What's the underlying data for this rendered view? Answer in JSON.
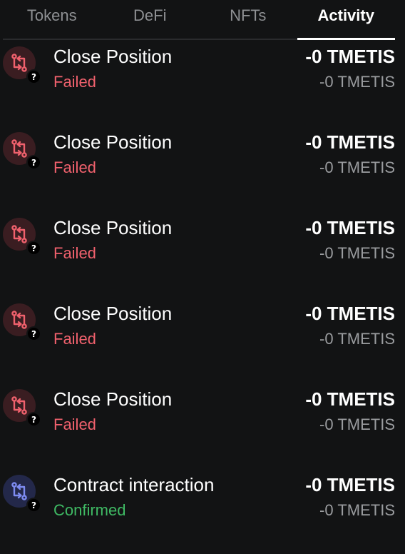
{
  "tabs": [
    {
      "label": "Tokens",
      "active": false
    },
    {
      "label": "DeFi",
      "active": false
    },
    {
      "label": "NFTs",
      "active": false
    },
    {
      "label": "Activity",
      "active": true
    }
  ],
  "activity": [
    {
      "title": "Close Position",
      "status": "Failed",
      "status_kind": "failed",
      "amount": "-0 TMETIS",
      "secondary_amount": "-0 TMETIS",
      "icon": "swap-arrows-icon",
      "badge": "?"
    },
    {
      "title": "Close Position",
      "status": "Failed",
      "status_kind": "failed",
      "amount": "-0 TMETIS",
      "secondary_amount": "-0 TMETIS",
      "icon": "swap-arrows-icon",
      "badge": "?"
    },
    {
      "title": "Close Position",
      "status": "Failed",
      "status_kind": "failed",
      "amount": "-0 TMETIS",
      "secondary_amount": "-0 TMETIS",
      "icon": "swap-arrows-icon",
      "badge": "?"
    },
    {
      "title": "Close Position",
      "status": "Failed",
      "status_kind": "failed",
      "amount": "-0 TMETIS",
      "secondary_amount": "-0 TMETIS",
      "icon": "swap-arrows-icon",
      "badge": "?"
    },
    {
      "title": "Close Position",
      "status": "Failed",
      "status_kind": "failed",
      "amount": "-0 TMETIS",
      "secondary_amount": "-0 TMETIS",
      "icon": "swap-arrows-icon",
      "badge": "?"
    },
    {
      "title": "Contract interaction",
      "status": "Confirmed",
      "status_kind": "confirmed",
      "amount": "-0 TMETIS",
      "secondary_amount": "-0 TMETIS",
      "icon": "swap-arrows-icon",
      "badge": "?"
    }
  ],
  "colors": {
    "background": "#121314",
    "failed": "#f0616d",
    "confirmed": "#3fba64",
    "failed_icon": "#f0616d",
    "confirmed_icon": "#7e8cf2"
  }
}
